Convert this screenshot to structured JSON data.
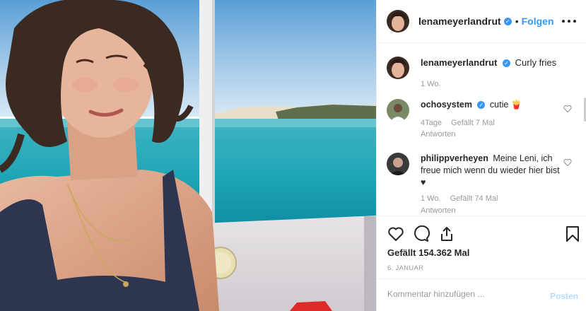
{
  "post": {
    "author": "lenameyerlandrut",
    "dot": "•",
    "follow_label": "Folgen",
    "verified_glyph": "✓"
  },
  "comments": [
    {
      "username": "lenameyerlandrut",
      "text": "Curly fries",
      "time": "1 Wo.",
      "verified": true
    },
    {
      "username": "ochosystem",
      "text": "cutie 🍟",
      "time": "4Tage",
      "likes": "Gefällt 7 Mal",
      "reply": "Antworten",
      "verified": true
    },
    {
      "username": "philippverheyen",
      "text": "Meine Leni, ich freue mich wenn du wieder hier bist ♥",
      "time": "1 Wo.",
      "likes": "Gefällt 74 Mal",
      "reply": "Antworten"
    }
  ],
  "actions": {
    "icons": [
      "heart-icon",
      "comment-icon",
      "share-icon",
      "bookmark-icon"
    ],
    "likes_text": "Gefällt 154.362 Mal",
    "date": "6. JANUAR"
  },
  "add_comment": {
    "placeholder": "Kommentar hinzufügen ...",
    "post_label": "Posten"
  },
  "colors": {
    "accent": "#3897f0",
    "text": "#262626",
    "muted": "#999999",
    "post_disabled": "#b3dbff"
  }
}
